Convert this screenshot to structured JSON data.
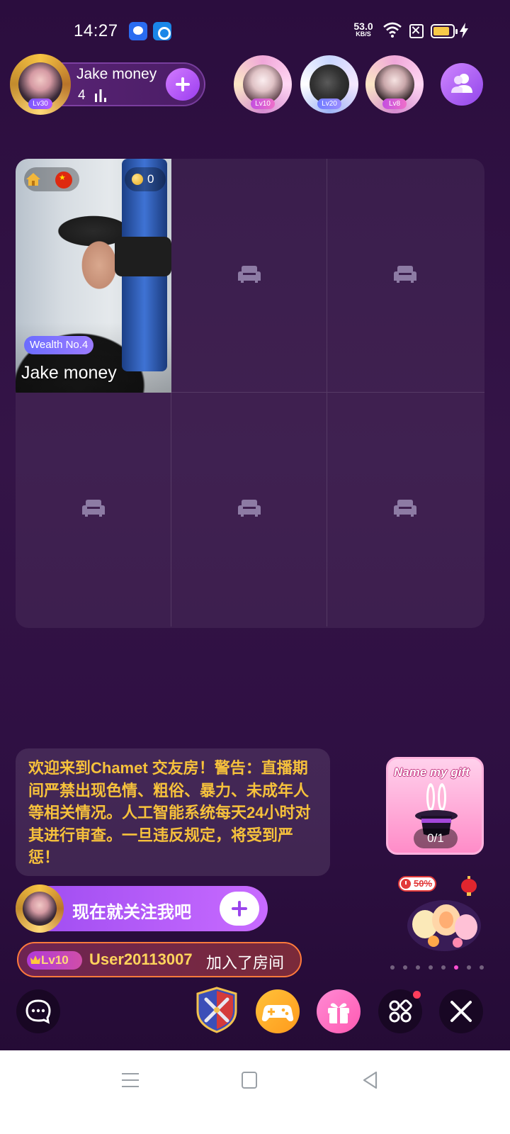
{
  "status_bar": {
    "time": "14:27",
    "net_speed_value": "53.0",
    "net_speed_unit": "KB/S",
    "icons": [
      "baidu-app-icon",
      "blue-app-icon",
      "wifi-icon",
      "sim-off-icon",
      "battery-icon",
      "charging-bolt-icon"
    ],
    "battery_color": "#f7c948"
  },
  "host": {
    "name": "Jake money",
    "count": "4",
    "level": "Lv30"
  },
  "viewers": [
    {
      "level": "Lv10"
    },
    {
      "level": "Lv20"
    },
    {
      "level": "Lv8"
    }
  ],
  "seats": {
    "occupied": {
      "name": "Jake money",
      "beans": "0",
      "wealth_label": "Wealth No.4"
    },
    "empty_icon": "sofa-icon"
  },
  "chat": {
    "announcement": "欢迎来到Chamet 交友房！警告：直播期间严禁出现色情、粗俗、暴力、未成年人等相关情况。人工智能系统每天24小时对其进行审查。一旦违反规定，将受到严惩！",
    "follow_prompt": "现在就关注我吧",
    "join_notice": {
      "level": "Lv10",
      "user": "User20113007",
      "action": "加入了房间"
    }
  },
  "gift_card": {
    "title": "Name my gift",
    "progress": "0/1"
  },
  "promo": {
    "discount": "50%"
  },
  "pager": {
    "count": 8,
    "active_index": 5
  },
  "toolbar": [
    "chat-button",
    "pk-button",
    "game-button",
    "gift-button",
    "more-button",
    "close-button"
  ],
  "colors": {
    "accent": "#9d4bf0",
    "announcement_text": "#f6c13c",
    "join_border": "#ff7a3c"
  }
}
